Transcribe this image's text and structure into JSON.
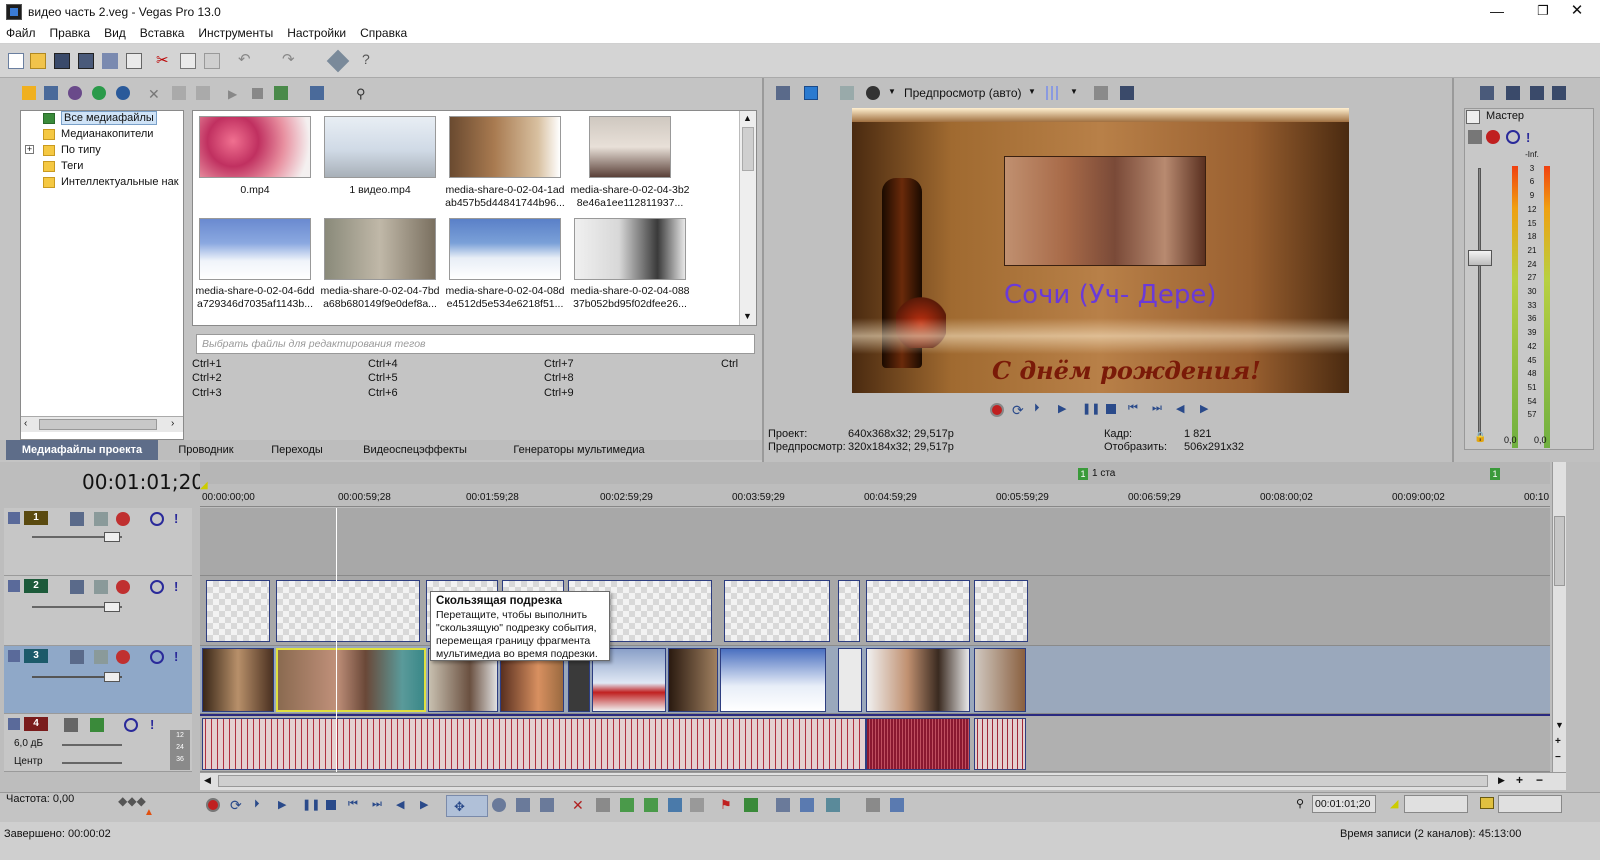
{
  "window": {
    "title": "видео часть 2.veg - Vegas Pro 13.0",
    "minimize": "—",
    "maximize": "❐",
    "close": "✕"
  },
  "menu": [
    "Файл",
    "Правка",
    "Вид",
    "Вставка",
    "Инструменты",
    "Настройки",
    "Справка"
  ],
  "explorer": {
    "tree": [
      "Все медиафайлы",
      "Медианакопители",
      "По типу",
      "Теги",
      "Интеллектуальные нак"
    ],
    "expander": "+",
    "media": [
      {
        "name": "0.mp4",
        "line2": ""
      },
      {
        "name": "1 видео.mp4",
        "line2": ""
      },
      {
        "name": "media-share-0-02-04-1ad",
        "line2": "ab457b5d44841744b96..."
      },
      {
        "name": "media-share-0-02-04-3b2",
        "line2": "8e46a1ee112811937..."
      },
      {
        "name": "media-share-0-02-04-6dd",
        "line2": "a729346d7035af1143b..."
      },
      {
        "name": "media-share-0-02-04-7bd",
        "line2": "a68b680149f9e0def8a..."
      },
      {
        "name": "media-share-0-02-04-08d",
        "line2": "e4512d5e534e6218f51..."
      },
      {
        "name": "media-share-0-02-04-088",
        "line2": "37b052bd95f02dfee26..."
      }
    ],
    "tag_placeholder": "Выбрать файлы для редактирования тегов",
    "shortcuts": [
      "Ctrl+1",
      "Ctrl+4",
      "Ctrl+7",
      "Ctrl",
      "Ctrl+2",
      "Ctrl+5",
      "Ctrl+8",
      "Ctrl+3",
      "Ctrl+6",
      "Ctrl+9"
    ],
    "tabs": [
      "Медиафайлы проекта",
      "Проводник",
      "Переходы",
      "Видеоспецэффекты",
      "Генераторы мультимедиа"
    ]
  },
  "preview": {
    "mode": "Предпросмотр (авто)",
    "overlay_text": "Сочи (Уч- Дере)",
    "greeting": "С днём рождения!",
    "project_label": "Проект:",
    "project_value": "640x368x32; 29,517p",
    "preview_label": "Предпросмотр:",
    "preview_value": "320x184x32; 29,517p",
    "frame_label": "Кадр:",
    "frame_value": "1 821",
    "display_label": "Отобразить:",
    "display_value": "506x291x32"
  },
  "mixer": {
    "master_label": "Мастер",
    "scale": [
      "-Inf.",
      "3",
      "6",
      "9",
      "12",
      "15",
      "18",
      "21",
      "24",
      "27",
      "30",
      "33",
      "36",
      "39",
      "42",
      "45",
      "48",
      "51",
      "54",
      "57"
    ],
    "readout_left": "0,0",
    "readout_right": "0,0"
  },
  "timeline": {
    "timecode": "00:01:01;20",
    "marker_label": "1 ста",
    "marker2": "1",
    "ruler": [
      "00:00:00;00",
      "00:00:59;28",
      "00:01:59;28",
      "00:02:59;29",
      "00:03:59;29",
      "00:04:59;29",
      "00:05:59;29",
      "00:06:59;29",
      "00:08:00;02",
      "00:09:00;02",
      "00:10"
    ],
    "tracks": [
      {
        "num": "1",
        "color": "#5a4a10"
      },
      {
        "num": "2",
        "color": "#1c5a3a"
      },
      {
        "num": "3",
        "color": "#1c5a6a"
      },
      {
        "num": "4",
        "color": "#7a1c1c"
      }
    ],
    "audio_volume": "6,0 дБ",
    "audio_pan": "Центр",
    "audio_meter": [
      "12",
      "24",
      "36"
    ],
    "tooltip_title": "Скользящая подрезка",
    "tooltip_body": "Перетащите, чтобы выполнить \"скользящую\" подрезку события, перемещая границу фрагмента мультимедиа во время подрезки."
  },
  "transport": {
    "rate": "Частота: 0,00",
    "cursor_time": "00:01:01;20"
  },
  "status": {
    "left": "Завершено: 00:00:02",
    "right": "Время записи (2 каналов): 45:13:00"
  }
}
